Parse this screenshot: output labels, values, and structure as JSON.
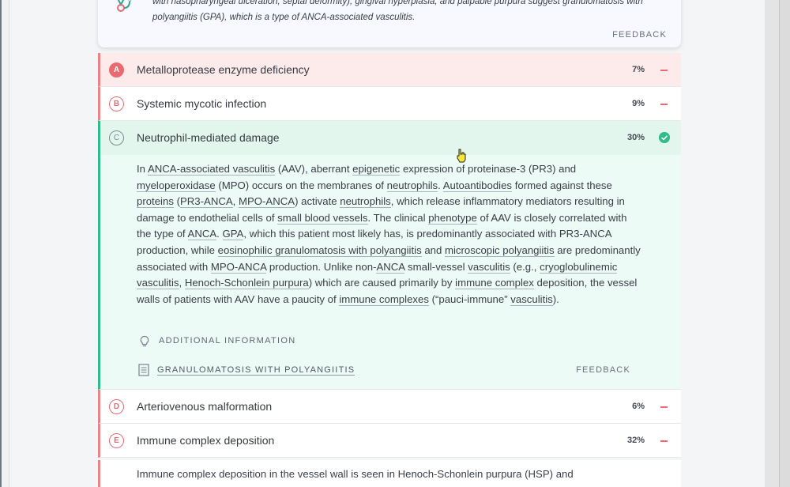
{
  "explanation_card": {
    "line1": "with nasopharyngeal ulceration, septal deformity), gingival hyperplasia, and palpable purpura suggest granulomatosis with",
    "line2": "polyangiitis (GPA), which is a type of ANCA-associated vasculitis.",
    "feedback_label": "FEEDBACK",
    "icon": "stethoscope-icon"
  },
  "choices": [
    {
      "letter": "A",
      "label": "Metalloprotease enzyme deficiency",
      "percent": "7%",
      "status": "wrong-selected"
    },
    {
      "letter": "B",
      "label": "Systemic mycotic infection",
      "percent": "9%",
      "status": "wrong"
    },
    {
      "letter": "C",
      "label": "Neutrophil-mediated damage",
      "percent": "30%",
      "status": "correct"
    },
    {
      "letter": "D",
      "label": "Arteriovenous malformation",
      "percent": "6%",
      "status": "wrong"
    },
    {
      "letter": "E",
      "label": "Immune complex deposition",
      "percent": "32%",
      "status": "wrong"
    }
  ],
  "correct_explanation": {
    "additional_info_label": "ADDITIONAL INFORMATION",
    "article_link": "GRANULOMATOSIS WITH POLYANGIITIS",
    "feedback_label": "FEEDBACK"
  },
  "choice_e_explanation_start": "Immune complex deposition in the vessel wall is seen in Henoch-Schonlein purpura (HSP) and",
  "colors": {
    "correct_green": "#30bd8b",
    "wrong_red": "#e96a70",
    "selected_wrong_bg": "#fdebeb",
    "correct_bg": "#e2f6ee"
  }
}
